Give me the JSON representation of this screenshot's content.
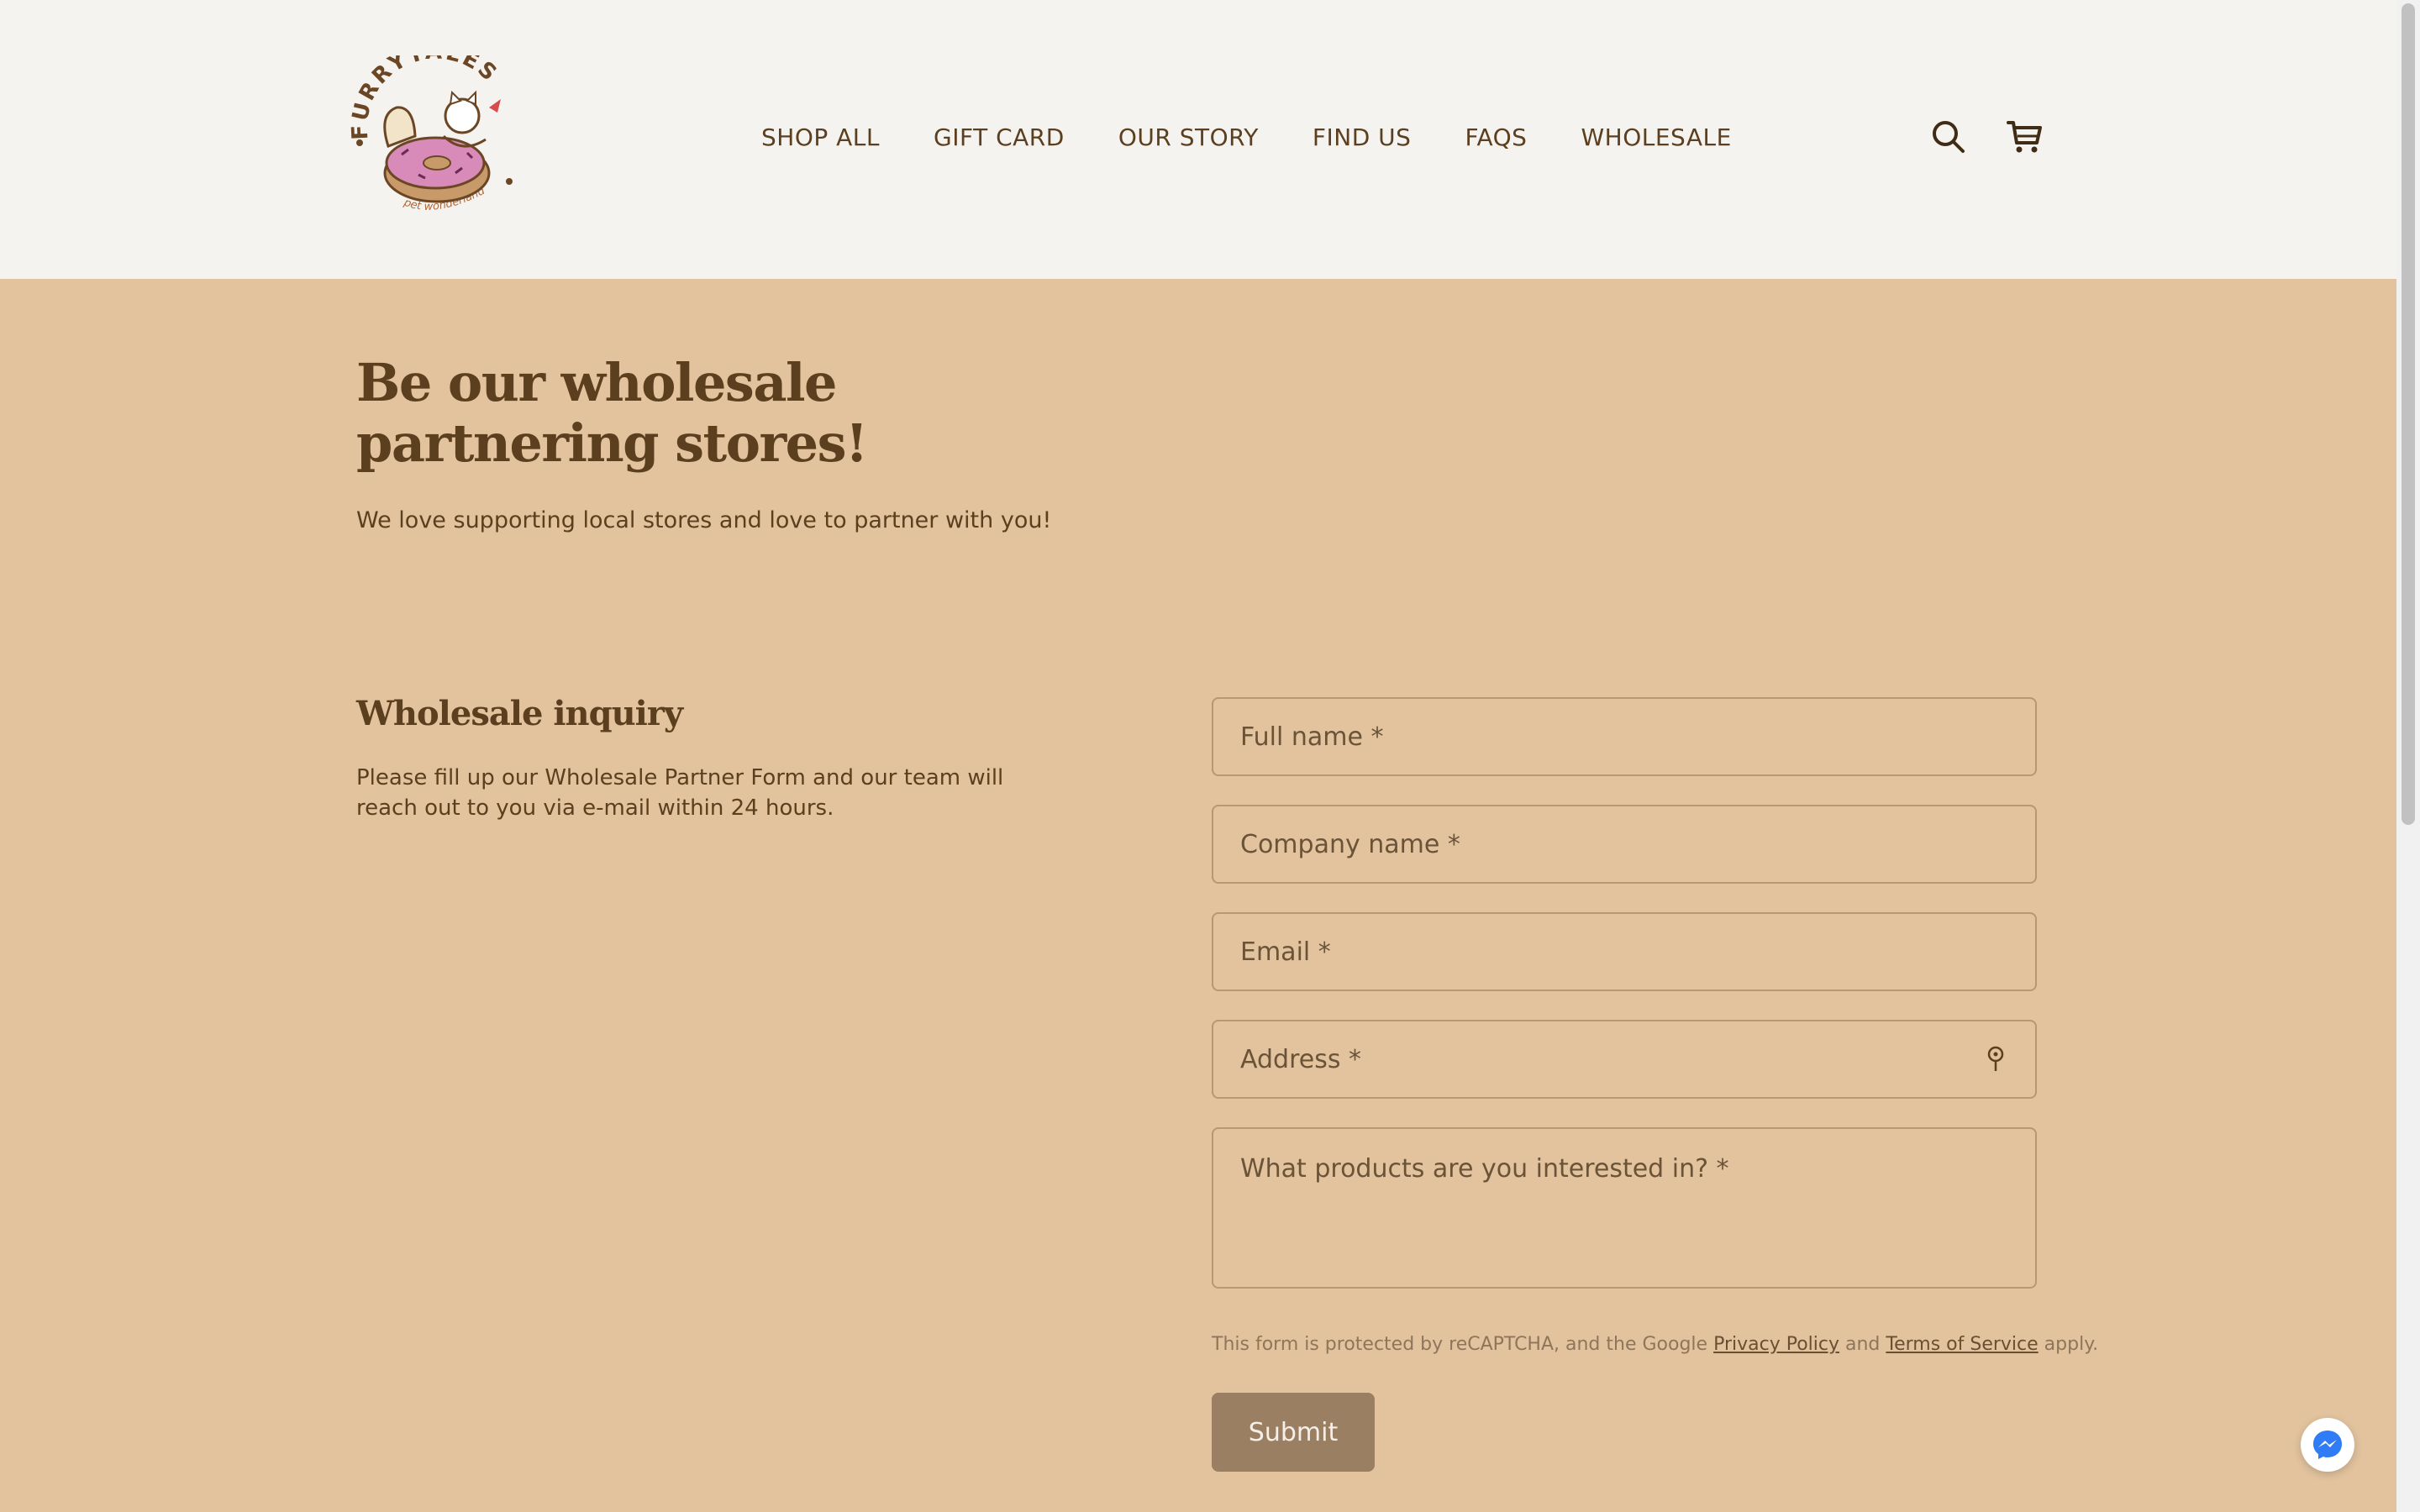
{
  "header": {
    "logo_text": "FURRYTALES",
    "logo_tagline": "pet wonderland",
    "nav": [
      "SHOP ALL",
      "GIFT CARD",
      "OUR STORY",
      "FIND US",
      "FAQS",
      "WHOLESALE"
    ],
    "icons": [
      "search-icon",
      "cart-icon"
    ]
  },
  "hero": {
    "title": "Be our wholesale partnering stores!",
    "subtitle": "We love supporting local stores and love to partner with you!"
  },
  "inquiry": {
    "title": "Wholesale inquiry",
    "text": "Please fill up our Wholesale Partner Form and our team will reach out to you via e-mail within 24 hours."
  },
  "form": {
    "full_name_placeholder": "Full name *",
    "company_placeholder": "Company name *",
    "email_placeholder": "Email *",
    "address_placeholder": "Address *",
    "products_placeholder": "What products are you interested in? *",
    "recaptcha_prefix": "This form is protected by reCAPTCHA, and the Google ",
    "privacy_link": "Privacy Policy",
    "and_text": " and ",
    "terms_link": "Terms of Service",
    "recaptcha_suffix": " apply.",
    "submit_label": "Submit"
  },
  "colors": {
    "page_bg": "#e2c39e",
    "header_bg": "#f5f3ef",
    "text": "#5b3f1f",
    "submit_bg": "#9b7f63"
  }
}
